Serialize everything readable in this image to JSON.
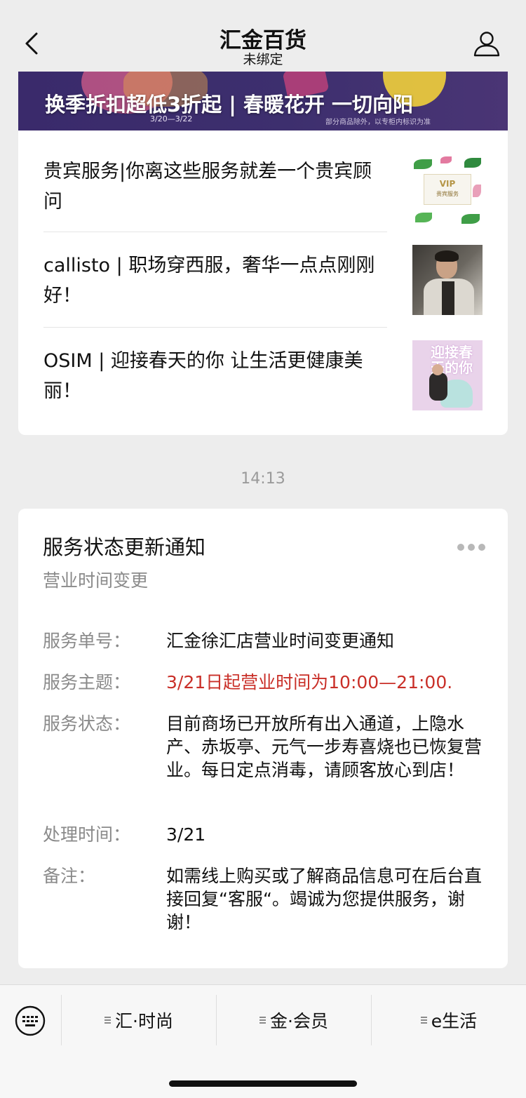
{
  "nav": {
    "title": "汇金百货",
    "subtitle": "未绑定"
  },
  "banner": {
    "title": "换季折扣超低3折起 | 春暖花开 一切向阳",
    "date": "3/20—3/22",
    "note": "部分商品除外，以专柜内标识为准"
  },
  "articles": [
    {
      "text": "贵宾服务|你离这些服务就差一个贵宾顾问",
      "thumb_label": "VIP",
      "thumb_sub": "贵宾服务"
    },
    {
      "text": "callisto | 职场穿西服，奢华一点点刚刚好！"
    },
    {
      "text": "OSIM | 迎接春天的你 让生活更健康美丽！",
      "thumb_label": "迎接春天的你"
    }
  ],
  "time": "14:13",
  "notice": {
    "title": "服务状态更新通知",
    "subtitle": "营业时间变更",
    "fields": [
      {
        "label": "服务单号：",
        "value": "汇金徐汇店营业时间变更通知"
      },
      {
        "label": "服务主题：",
        "value": "3/21日起营业时间为10:00—21:00."
      },
      {
        "label": "服务状态：",
        "value": "目前商场已开放所有出入通道，上隐水产、赤坂亭、元气一步寿喜烧也已恢复营业。每日定点消毒，请顾客放心到店！"
      },
      {
        "label": "处理时间：",
        "value": "3/21"
      },
      {
        "label": "备注：",
        "value": "如需线上购买或了解商品信息可在后台直接回复“客服“。竭诚为您提供服务，谢谢！"
      }
    ]
  },
  "menu": {
    "items": [
      {
        "label": "汇·时尚"
      },
      {
        "label": "金·会员"
      },
      {
        "label": "e生活"
      }
    ]
  },
  "colors": {
    "highlight_red": "#c92f28",
    "background": "#ededed"
  }
}
